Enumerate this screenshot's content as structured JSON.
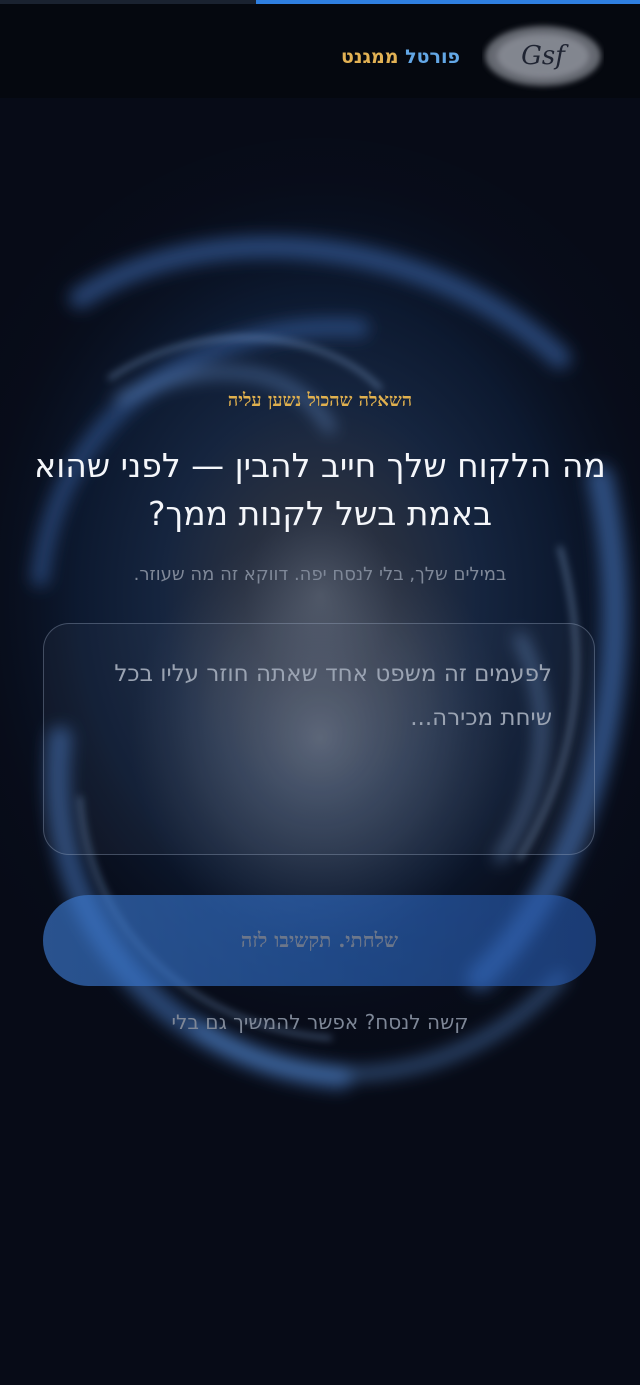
{
  "header": {
    "brand_part1": "פורטל",
    "brand_part2": "ממגנט",
    "logo_text": "Gsf"
  },
  "progress": {
    "value_fraction": 0.6,
    "fill_color": "#2f7fe0"
  },
  "question": {
    "eyebrow": "השאלה שהכול נשען עליה",
    "headline": "מה הלקוח שלך חייב להבין — לפני שהוא באמת בשל לקנות ממך?",
    "subline": "במילים שלך, בלי לנסח יפה. דווקא זה מה שעוזר."
  },
  "answer": {
    "value": "",
    "placeholder": "לפעמים זה משפט אחד שאתה חוזר עליו בכל שיחת מכירה..."
  },
  "actions": {
    "submit_label": "שלחתי. תקשיבו לזה",
    "skip_label": "קשה לנסח? אפשר להמשיך גם בלי"
  },
  "colors": {
    "accent_gold": "#e3b254",
    "accent_blue": "#63a7e6",
    "button_blue": "#3f7fd8",
    "background": "#070b17"
  }
}
